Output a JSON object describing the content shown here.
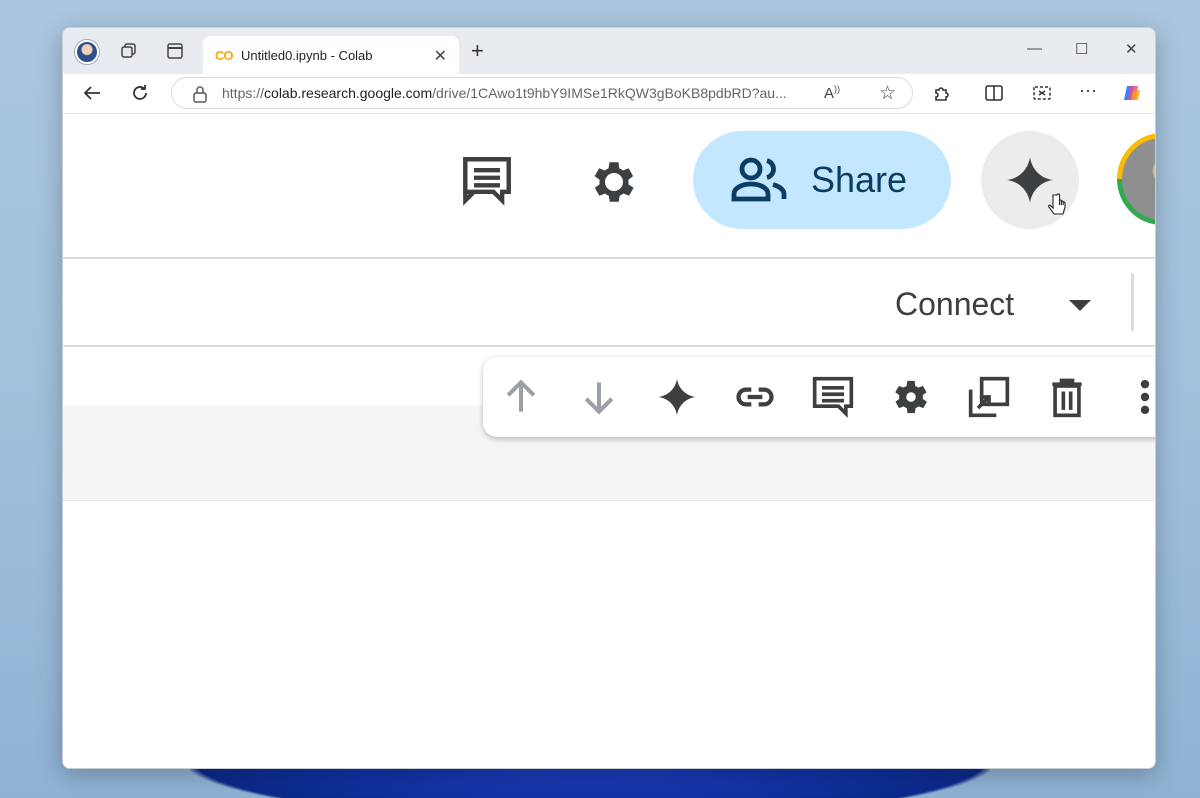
{
  "browser": {
    "tab_title": "Untitled0.ipynb - Colab",
    "tab_favicon": "CO",
    "url_prefix": "https://",
    "url_host": "colab.research.google.com",
    "url_path": "/drive/1CAwo1t9hbY9IMSe1RkQW3gBoKB8pdbRD?au..."
  },
  "colab": {
    "share_label": "Share",
    "connect_label": "Connect"
  },
  "icons": {
    "comment": "comment-icon",
    "settings": "gear-icon",
    "share": "people-icon",
    "gemini": "sparkle-icon",
    "move_up": "arrow-up-icon",
    "move_down": "arrow-down-icon",
    "link": "link-icon",
    "delete": "trash-icon",
    "more": "more-vert-icon"
  },
  "colors": {
    "share_bg": "#c2e7ff",
    "share_text": "#0b3d62",
    "icon_dark": "#3c4043",
    "icon_disabled": "#9aa0a6"
  }
}
